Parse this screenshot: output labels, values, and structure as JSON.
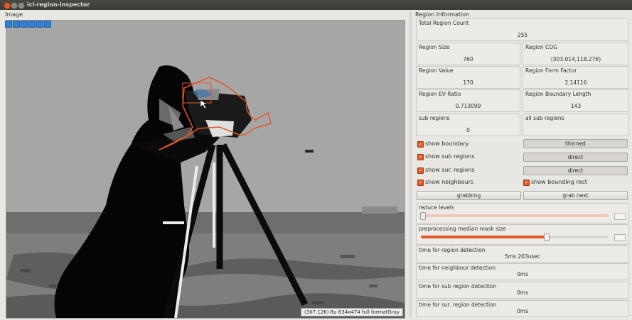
{
  "window": {
    "title": "icl-region-inspector"
  },
  "image_panel": {
    "label": "Image",
    "status": "(307,126) 8u 634x474 full formatGray"
  },
  "info": {
    "title": "Region Information",
    "total_count": {
      "label": "Total Region Count",
      "value": "255"
    },
    "size": {
      "label": "Region Size",
      "value": "760"
    },
    "cog": {
      "label": "Region COG",
      "value": "(303.014,118.276)"
    },
    "value": {
      "label": "Region Value",
      "value": "170"
    },
    "form_factor": {
      "label": "Region Form Factor",
      "value": "2.14116"
    },
    "ev_ratio": {
      "label": "Region EV-Ratio",
      "value": "0.713099"
    },
    "boundary_length": {
      "label": "Region Boundary Length",
      "value": "143"
    },
    "sub_regions": {
      "label": "sub regions",
      "value": "0"
    },
    "all_sub_regions": {
      "label": "all sub regions",
      "value": ""
    }
  },
  "controls": {
    "show_boundary": "show boundary",
    "thinned": "thinned",
    "show_sub_regions": "show sub regions",
    "direct1": "direct",
    "show_sur_regions": "show sur. regions",
    "direct2": "direct",
    "show_neighbours": "show neighbours",
    "show_bounding_rect": "show bounding rect",
    "grabbing": "grabbing",
    "grab_next": "grab next",
    "reduce_levels": "reduce levels",
    "median_mask": "preprocessing median mask size"
  },
  "timings": {
    "region": {
      "label": "time for region detection",
      "value": "5ms 203usec"
    },
    "neighbour": {
      "label": "time for neighbour detection",
      "value": "0ms"
    },
    "sub_region": {
      "label": "time for sub region detection",
      "value": "0ms"
    },
    "sur_region": {
      "label": "time for sur. region detection",
      "value": "0ms"
    }
  },
  "colors": {
    "accent": "#e3592a",
    "boundary": "#e0582a"
  }
}
